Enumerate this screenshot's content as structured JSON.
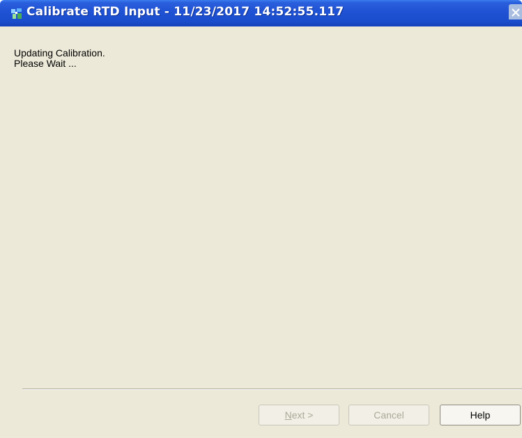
{
  "window": {
    "title": "Calibrate RTD Input - 11/23/2017 14:52:55.117",
    "icon": "app-icon"
  },
  "status": {
    "line1": "Updating Calibration.",
    "line2": "Please Wait ..."
  },
  "buttons": {
    "next_label": "Next >",
    "cancel_label": "Cancel",
    "help_label": "Help"
  }
}
